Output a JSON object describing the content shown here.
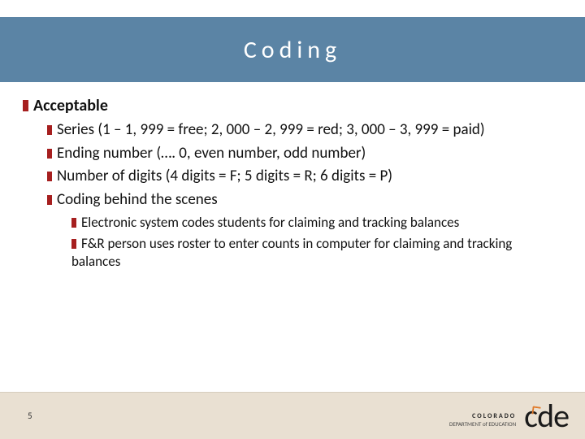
{
  "title": "Coding",
  "heading": "Acceptable",
  "bullets_lvl1": [
    "Series (1 – 1, 999 = free; 2, 000 – 2, 999 = red; 3, 000 – 3, 999 = paid)",
    "Ending number (…. 0, even number, odd number)",
    "Number of digits (4 digits = F; 5 digits = R; 6 digits = P)",
    "Coding behind the scenes"
  ],
  "bullets_lvl2": [
    "Electronic system codes students for claiming and tracking balances",
    "F&R person uses roster to enter counts in computer for claiming and tracking balances"
  ],
  "page_number": "5",
  "logo": {
    "line1": "COLORADO",
    "line2": "DEPARTMENT of EDUCATION",
    "mark": "cde"
  }
}
